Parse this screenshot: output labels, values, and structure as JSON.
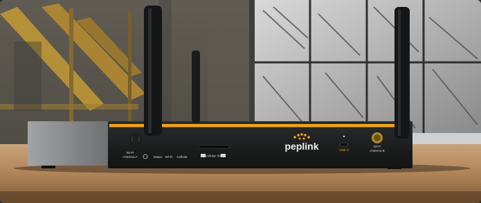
{
  "scene": {
    "description_free": true
  },
  "router": {
    "brand": "peplink",
    "port_labels": {
      "wifi_antenna_a": [
        "Wi-Fi",
        "Antenna A"
      ],
      "status": "Status",
      "wifi": "Wi-Fi",
      "cellular": "Cellular",
      "cellular_sim": "Cellular SIM",
      "usb_c": "USB-C",
      "wifi_antenna_b": [
        "Wi-Fi",
        "Antenna B"
      ]
    },
    "accent_color": "#f2a31b",
    "body_color": "#1c1d1e",
    "side_color": "#8d8e8f"
  },
  "colors": {
    "desk": "#b58a5e",
    "monitor_frame": "#4a4b4c",
    "warehouse_beam": "#c49a36"
  }
}
